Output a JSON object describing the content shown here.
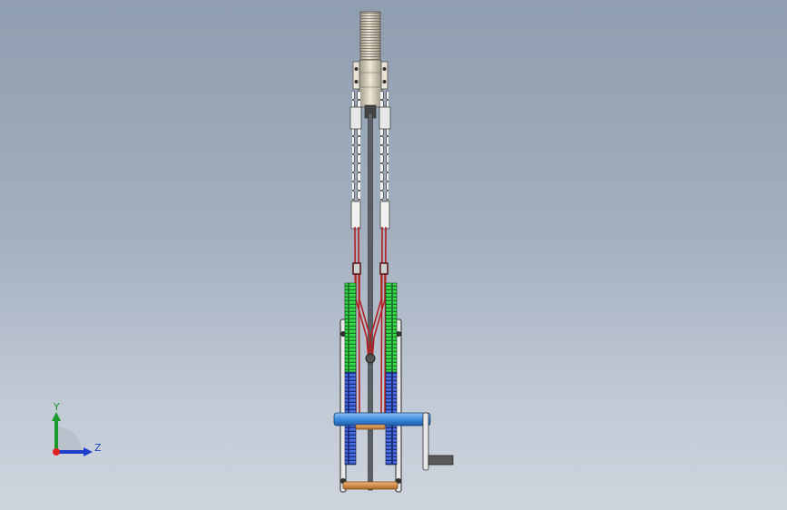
{
  "viewport": {
    "background_top": "#8f9db0",
    "background_bottom": "#cfd5de"
  },
  "model": {
    "parts": [
      "top-roller",
      "vertical-shaft",
      "left-chain",
      "right-chain",
      "red-linkage",
      "left-green-gear",
      "right-green-gear",
      "left-blue-gear",
      "right-blue-gear",
      "blue-axle",
      "orange-rod",
      "hand-crank",
      "side-frame"
    ],
    "colors": {
      "steel": "#d8d3c4",
      "shaft": "#5a5f66",
      "chain": "#e8e8e8",
      "linkage": "#b22222",
      "gear_green": "#2ecc40",
      "gear_blue": "#3a5ed8",
      "axle_blue": "#3d8de0",
      "rod_orange": "#d98a3d",
      "crank": "#707070"
    }
  },
  "triad": {
    "y_label": "Y",
    "z_label": "Z",
    "y_color": "#1a9a2a",
    "z_color": "#1e40c8",
    "origin_color": "#e02020"
  }
}
